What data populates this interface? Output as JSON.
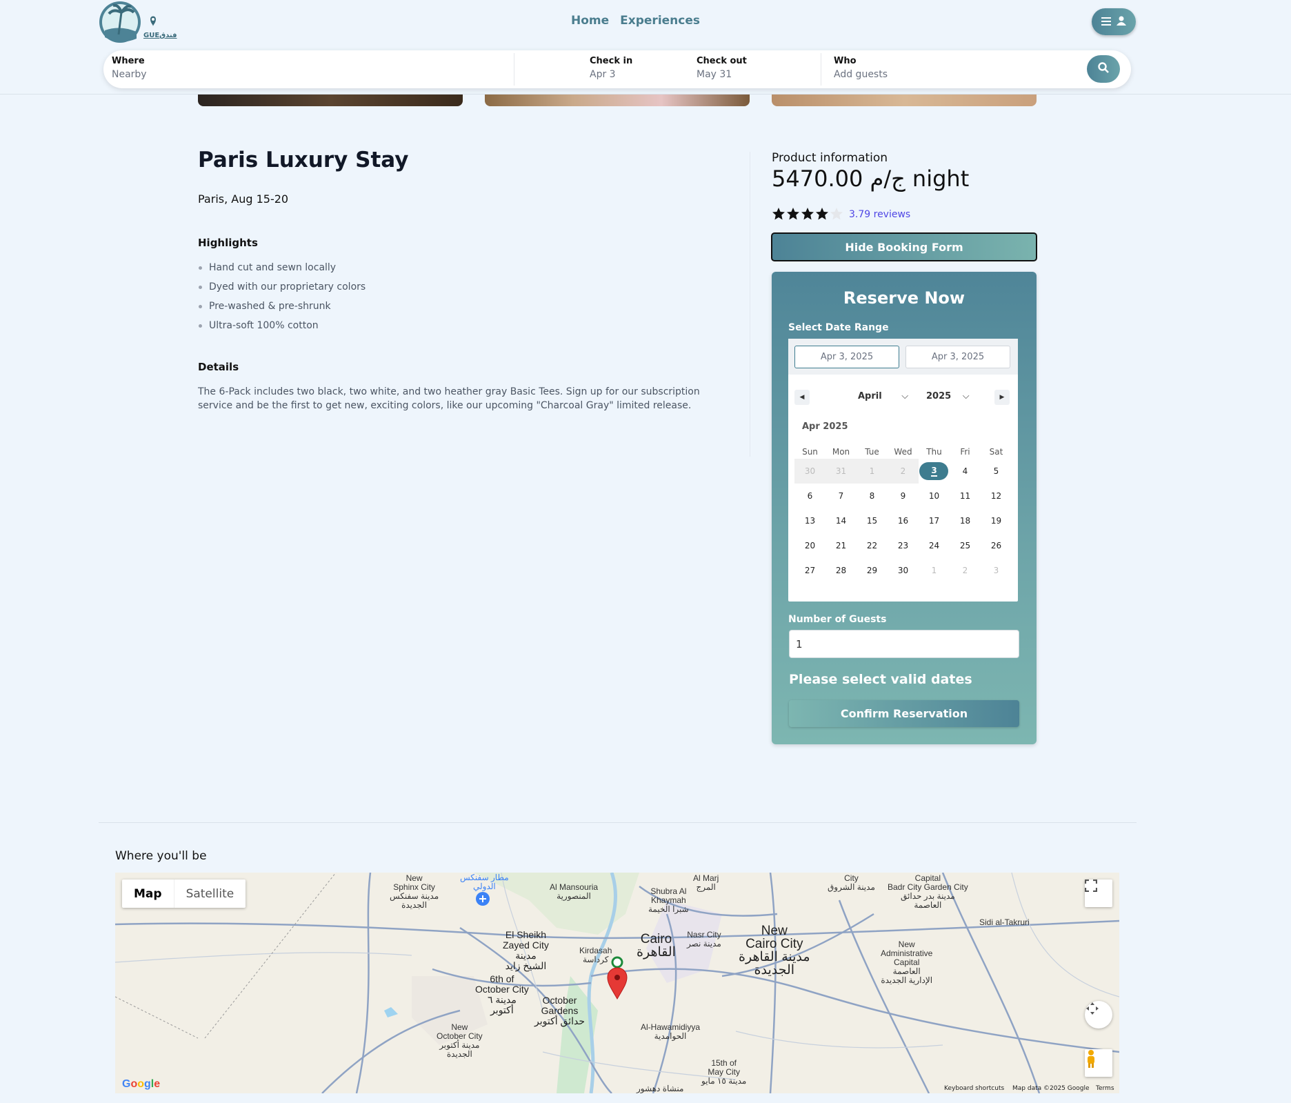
{
  "header": {
    "logo_text": "GUEفندق",
    "nav": [
      "Home",
      "Experiences"
    ],
    "search": {
      "where_label": "Where",
      "where_value": "Nearby",
      "checkin_label": "Check in",
      "checkin_value": "Apr 3",
      "checkout_label": "Check out",
      "checkout_value": "May 31",
      "who_label": "Who",
      "who_value": "Add guests"
    }
  },
  "listing": {
    "title": "Paris Luxury Stay",
    "subtitle": "Paris, Aug 15-20",
    "highlights_heading": "Highlights",
    "highlights": [
      "Hand cut and sewn locally",
      "Dyed with our proprietary colors",
      "Pre-washed & pre-shrunk",
      "Ultra-soft 100% cotton"
    ],
    "details_heading": "Details",
    "details_text": "The 6-Pack includes two black, two white, and two heather gray Basic Tees. Sign up for our subscription service and be the first to get new, exciting colors, like our upcoming \"Charcoal Gray\" limited release."
  },
  "booking": {
    "product_info_label": "Product information",
    "price": "5470.00 ج/م night",
    "rating": 4,
    "rating_max": 5,
    "reviews_text": "3.79 reviews",
    "hide_button": "Hide Booking Form",
    "reserve_title": "Reserve Now",
    "date_range_label": "Select Date Range",
    "start_date": "Apr 3, 2025",
    "end_date": "Apr 3, 2025",
    "month_select": "April",
    "year_select": "2025",
    "calendar_month": "Apr 2025",
    "weekdays": [
      "Sun",
      "Mon",
      "Tue",
      "Wed",
      "Thu",
      "Fri",
      "Sat"
    ],
    "weeks": [
      [
        "30",
        "31",
        "1",
        "2",
        "3",
        "4",
        "5"
      ],
      [
        "6",
        "7",
        "8",
        "9",
        "10",
        "11",
        "12"
      ],
      [
        "13",
        "14",
        "15",
        "16",
        "17",
        "18",
        "19"
      ],
      [
        "20",
        "21",
        "22",
        "23",
        "24",
        "25",
        "26"
      ],
      [
        "27",
        "28",
        "29",
        "30",
        "1",
        "2",
        "3"
      ]
    ],
    "selected_day": "3",
    "guests_label": "Number of Guests",
    "guests_value": "1",
    "validation_message": "Please select valid dates",
    "confirm_button": "Confirm Reservation"
  },
  "map": {
    "section_title": "Where you'll be",
    "type_map": "Map",
    "type_satellite": "Satellite",
    "logo": "Google",
    "footer_shortcuts": "Keyboard shortcuts",
    "footer_data": "Map data ©2025 Google",
    "footer_terms": "Terms",
    "labels": {
      "sphinx": "New\nSphinx City\nمدينة سفنكس\nالجديدة",
      "airport": "مطار سفنكس\nالدولي",
      "mansouria": "Al Mansouria\nالمنصورية",
      "shubra": "Shubra Al\nKhaymah\nشبرا الخيمة",
      "marj": "Al Marj\nالمرج",
      "city_sh": "City\nمدينة الشروق",
      "badr": "Capital\nBadr City Garden City\nمدينة بدر حدائق\nالعاصمة",
      "sidi": "Sidi al-Takruri",
      "sheikh": "El Sheikh\nZayed City\nمدينة\nالشيخ زايد",
      "kirdasah": "Kirdasah\nكرداسة",
      "cairo": "Cairo\nالقاهرة",
      "nasr": "Nasr City\nمدينة نصر",
      "newcairo": "New\nCairo City\nمدينة القاهرة\nالجديدة",
      "newadmin": "New\nAdministrative\nCapital\nالعاصمة\nالإدارية الجديدة",
      "october6": "6th of\nOctober City\nمدينة ٦\nأكتوبر",
      "ocgardens": "October\nGardens\nحدائق أكتوبر",
      "newoct": "New\nOctober City\nمدينة أكتوبر\nالجديدة",
      "hawamdiya": "Al-Hawamidiyya\nالحوامدية",
      "may15": "15th of\nMay City\nمدينة ١٥ مايو",
      "dahshur": "منشاة دهشور"
    }
  },
  "colors": {
    "accent": "#4d8396",
    "accent_light": "#7ab3ae",
    "page_bg": "#eef5fc",
    "link": "#4f46e5"
  }
}
